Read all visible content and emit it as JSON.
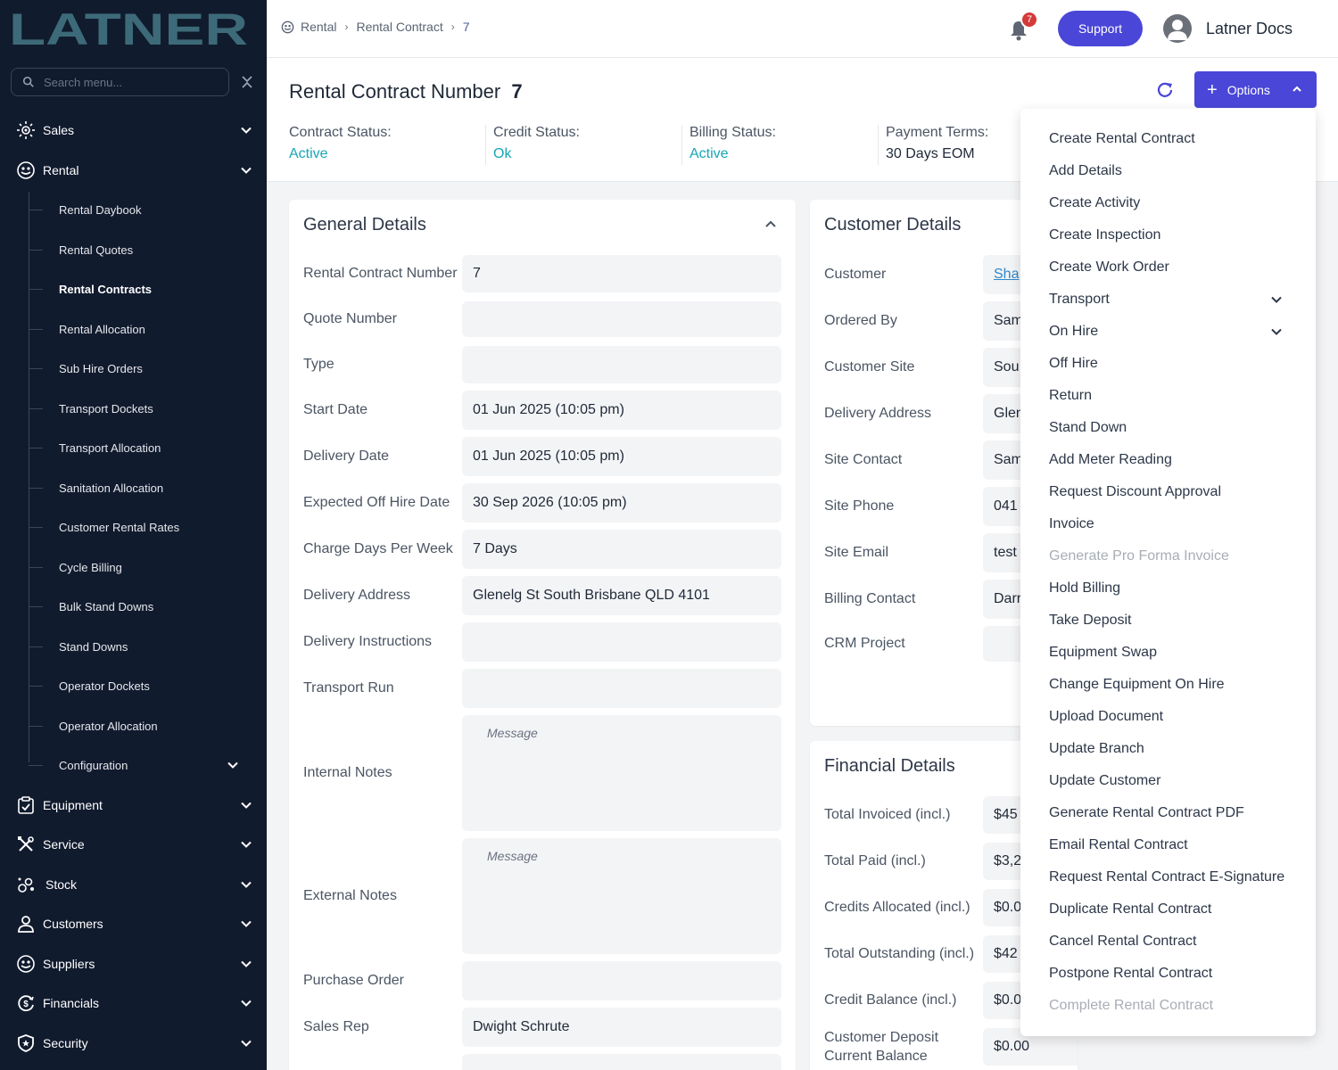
{
  "app": {
    "logo_text": "LATNER"
  },
  "sidebar": {
    "search_placeholder": "Search menu...",
    "sections": [
      {
        "label": "Sales"
      },
      {
        "label": "Rental"
      },
      {
        "label": "Equipment"
      },
      {
        "label": "Service"
      },
      {
        "label": "Stock"
      },
      {
        "label": "Customers"
      },
      {
        "label": "Suppliers"
      },
      {
        "label": "Financials"
      },
      {
        "label": "Security"
      }
    ],
    "rental_items": [
      {
        "label": "Rental Daybook"
      },
      {
        "label": "Rental Quotes"
      },
      {
        "label": "Rental Contracts"
      },
      {
        "label": "Rental Allocation"
      },
      {
        "label": "Sub Hire Orders"
      },
      {
        "label": "Transport Dockets"
      },
      {
        "label": "Transport Allocation"
      },
      {
        "label": "Sanitation Allocation"
      },
      {
        "label": "Customer Rental Rates"
      },
      {
        "label": "Cycle Billing"
      },
      {
        "label": "Bulk Stand Downs"
      },
      {
        "label": "Stand Downs"
      },
      {
        "label": "Operator Dockets"
      },
      {
        "label": "Operator Allocation"
      },
      {
        "label": "Configuration"
      }
    ],
    "active_item": "Rental Contracts"
  },
  "header": {
    "breadcrumb": [
      "Rental",
      "Rental Contract",
      "7"
    ],
    "notification_count": "7",
    "support_label": "Support",
    "user_name": "Latner Docs"
  },
  "contract": {
    "title_label": "Rental Contract Number",
    "number": "7",
    "options_label": "Options",
    "stats": [
      {
        "label": "Contract Status:",
        "value": "Active"
      },
      {
        "label": "Credit Status:",
        "value": "Ok"
      },
      {
        "label": "Billing Status:",
        "value": "Active"
      },
      {
        "label": "Payment Terms:",
        "value": "30 Days EOM"
      }
    ]
  },
  "general_details": {
    "title": "General Details",
    "fields": [
      {
        "label": "Rental Contract Number",
        "value": "7"
      },
      {
        "label": "Quote Number",
        "value": ""
      },
      {
        "label": "Type",
        "value": ""
      },
      {
        "label": "Start Date",
        "value": "01 Jun 2025 (10:05 pm)"
      },
      {
        "label": "Delivery Date",
        "value": "01 Jun 2025 (10:05 pm)"
      },
      {
        "label": "Expected Off Hire Date",
        "value": "30 Sep 2026 (10:05 pm)"
      },
      {
        "label": "Charge Days Per Week",
        "value": "7 Days"
      },
      {
        "label": "Delivery Address",
        "value": "Glenelg St South Brisbane QLD 4101"
      },
      {
        "label": "Delivery Instructions",
        "value": ""
      },
      {
        "label": "Transport Run",
        "value": ""
      },
      {
        "label": "Internal Notes",
        "placeholder": "Message"
      },
      {
        "label": "External Notes",
        "placeholder": "Message"
      },
      {
        "label": "Purchase Order",
        "value": ""
      },
      {
        "label": "Sales Rep",
        "value": "Dwight Schrute"
      }
    ]
  },
  "customer_details": {
    "title": "Customer Details",
    "fields": [
      {
        "label": "Customer",
        "value": "Sha"
      },
      {
        "label": "Ordered By",
        "value": "Sam"
      },
      {
        "label": "Customer Site",
        "value": "Sou"
      },
      {
        "label": "Delivery Address",
        "value": "Glen"
      },
      {
        "label": "Site Contact",
        "value": "Sam"
      },
      {
        "label": "Site Phone",
        "value": "041"
      },
      {
        "label": "Site Email",
        "value": "test"
      },
      {
        "label": "Billing Contact",
        "value": "Darr"
      },
      {
        "label": "CRM Project",
        "value": ""
      }
    ]
  },
  "financial_details": {
    "title": "Financial Details",
    "fields": [
      {
        "label": "Total Invoiced (incl.)",
        "value": "$45"
      },
      {
        "label": "Total Paid (incl.)",
        "value": "$3,2"
      },
      {
        "label": "Credits Allocated (incl.)",
        "value": "$0.0"
      },
      {
        "label": "Total Outstanding (incl.)",
        "value": "$42"
      },
      {
        "label": "Credit Balance (incl.)",
        "value": "$0.0"
      },
      {
        "label": "Customer Deposit Current Balance",
        "value": "$0.00"
      }
    ]
  },
  "options_menu": [
    {
      "label": "Create Rental Contract"
    },
    {
      "label": "Add Details"
    },
    {
      "label": "Create Activity"
    },
    {
      "label": "Create Inspection"
    },
    {
      "label": "Create Work Order"
    },
    {
      "label": "Transport",
      "expandable": true
    },
    {
      "label": "On Hire",
      "expandable": true
    },
    {
      "label": "Off Hire"
    },
    {
      "label": "Return"
    },
    {
      "label": "Stand Down"
    },
    {
      "label": "Add Meter Reading"
    },
    {
      "label": "Request Discount Approval"
    },
    {
      "label": "Invoice"
    },
    {
      "label": "Generate Pro Forma Invoice",
      "disabled": true
    },
    {
      "label": "Hold Billing"
    },
    {
      "label": "Take Deposit"
    },
    {
      "label": "Equipment Swap"
    },
    {
      "label": "Change Equipment On Hire"
    },
    {
      "label": "Upload Document"
    },
    {
      "label": "Update Branch"
    },
    {
      "label": "Update Customer"
    },
    {
      "label": "Generate Rental Contract PDF"
    },
    {
      "label": "Email Rental Contract"
    },
    {
      "label": "Request Rental Contract E-Signature"
    },
    {
      "label": "Duplicate Rental Contract"
    },
    {
      "label": "Cancel Rental Contract"
    },
    {
      "label": "Postpone Rental Contract"
    },
    {
      "label": "Complete Rental Contract",
      "disabled": true
    }
  ],
  "colors": {
    "sidebar_bg": "#111b2e",
    "accent": "#4a46d8",
    "status_green": "#16a6b4",
    "logo": "#3d6a78"
  }
}
